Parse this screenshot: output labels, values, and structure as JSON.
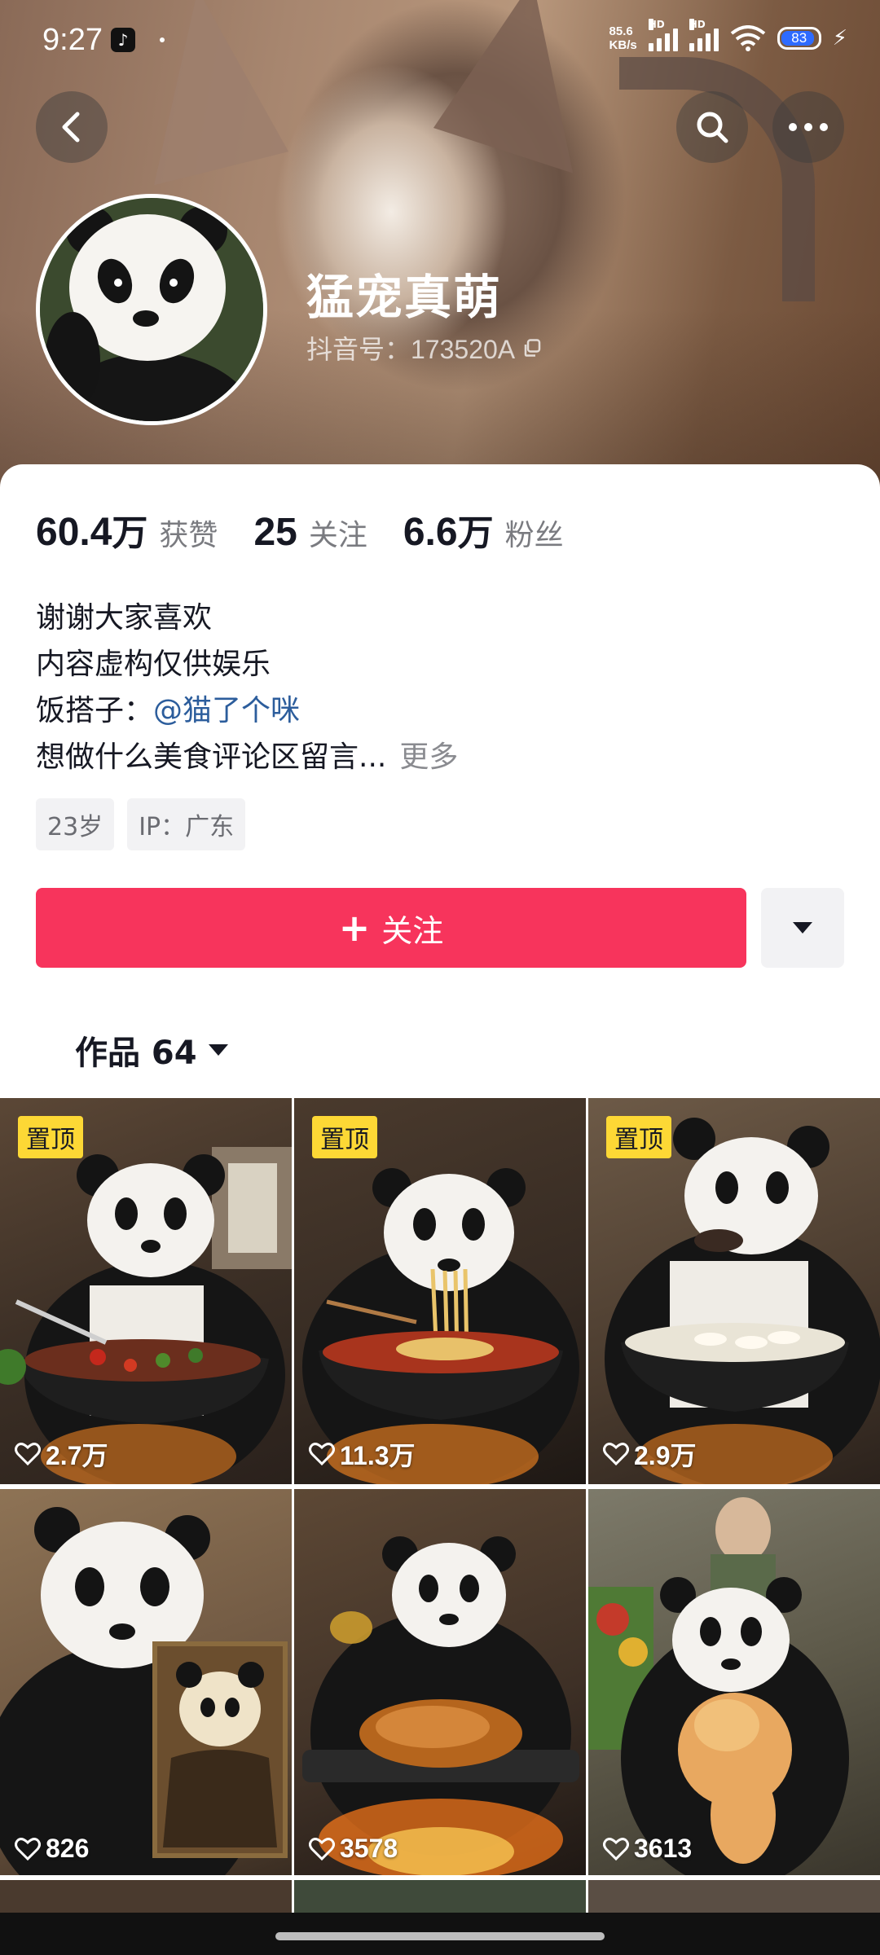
{
  "status_bar": {
    "time": "9:27",
    "net_speed_value": "85.6",
    "net_speed_unit": "KB/s",
    "hd1": "HD",
    "hd2": "HD",
    "battery": "83"
  },
  "profile": {
    "nickname": "猛宠真萌",
    "douyin_id": "抖音号：173520A",
    "stats": [
      {
        "num": "60.4",
        "unit": "万",
        "label": "获赞"
      },
      {
        "num": "25",
        "unit": "",
        "label": "关注"
      },
      {
        "num": "6.6",
        "unit": "万",
        "label": "粉丝"
      }
    ],
    "bio": {
      "line1": "谢谢大家喜欢",
      "line2": "内容虚构仅供娱乐",
      "line3_prefix": "饭搭子：",
      "line3_mention": "@猫了个咪",
      "line4": "想做什么美食评论区留言...",
      "more": "更多"
    },
    "tags": [
      "23岁",
      "IP：广东"
    ],
    "follow_label": "关注"
  },
  "works_tab": {
    "label": "作品 64"
  },
  "grid": {
    "pin_label": "置顶",
    "items": [
      {
        "likes": "2.7万",
        "pinned": true
      },
      {
        "likes": "11.3万",
        "pinned": true
      },
      {
        "likes": "2.9万",
        "pinned": true
      },
      {
        "likes": "826",
        "pinned": false
      },
      {
        "likes": "3578",
        "pinned": false
      },
      {
        "likes": "3613",
        "pinned": false
      }
    ]
  },
  "colors": {
    "follow_button": "#f7345c",
    "mention": "#2c5d9c",
    "pin_badge": "#fdd835"
  }
}
